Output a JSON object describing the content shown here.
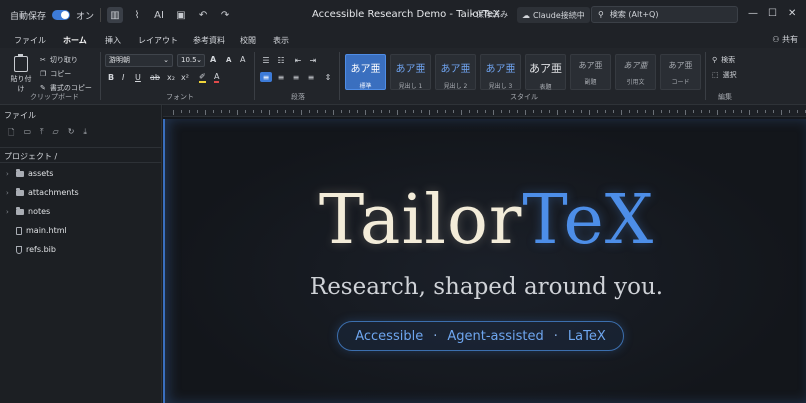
{
  "titlebar": {
    "autosave_label": "自動保存",
    "autosave_state": "オン",
    "ai_label": "AI",
    "doc_title": "Accessible Research Demo - TailorTeX",
    "saved_status": "・保存済み",
    "claude_status": "Claude接続中",
    "search_placeholder": "検索 (Alt+Q)"
  },
  "tabs": [
    {
      "label": "ファイル"
    },
    {
      "label": "ホーム"
    },
    {
      "label": "挿入"
    },
    {
      "label": "レイアウト"
    },
    {
      "label": "参考資料"
    },
    {
      "label": "校閲"
    },
    {
      "label": "表示"
    }
  ],
  "share_label": "共有",
  "ribbon": {
    "clipboard": {
      "paste": "貼り付け",
      "cut": "切り取り",
      "copy": "コピー",
      "format_copy": "書式のコピー",
      "group": "クリップボード"
    },
    "font": {
      "family": "游明朝",
      "size": "10.5",
      "group": "フォント"
    },
    "paragraph_group": "段落",
    "styles": [
      {
        "big": "あア亜",
        "small": "標準"
      },
      {
        "big": "あア亜",
        "small": "見出し 1"
      },
      {
        "big": "あア亜",
        "small": "見出し 2"
      },
      {
        "big": "あア亜",
        "small": "見出し 3"
      },
      {
        "big": "あア亜",
        "small": "表題"
      },
      {
        "big": "あア亜",
        "small": "副題"
      },
      {
        "big": "あア亜",
        "small": "引用文"
      },
      {
        "big": "あア亜",
        "small": "コード"
      }
    ],
    "styles_group": "スタイル",
    "edit": {
      "search": "検索",
      "select": "選択",
      "group": "編集"
    }
  },
  "sidebar": {
    "title": "ファイル",
    "path": "プロジェクト  /",
    "items": [
      {
        "type": "folder",
        "label": "assets"
      },
      {
        "type": "folder",
        "label": "attachments"
      },
      {
        "type": "folder",
        "label": "notes"
      },
      {
        "type": "file",
        "label": "main.html"
      },
      {
        "type": "file",
        "label": "refs.bib"
      }
    ]
  },
  "document": {
    "hero_part1": "Tailor",
    "hero_part2": "TeX",
    "tagline": "Research, shaped around you.",
    "pill": [
      "Accessible",
      "Agent-assisted",
      "LaTeX"
    ],
    "pill_separator": "·"
  },
  "colors": {
    "accent": "#4d8ee8",
    "cream": "#f3ecd9"
  }
}
